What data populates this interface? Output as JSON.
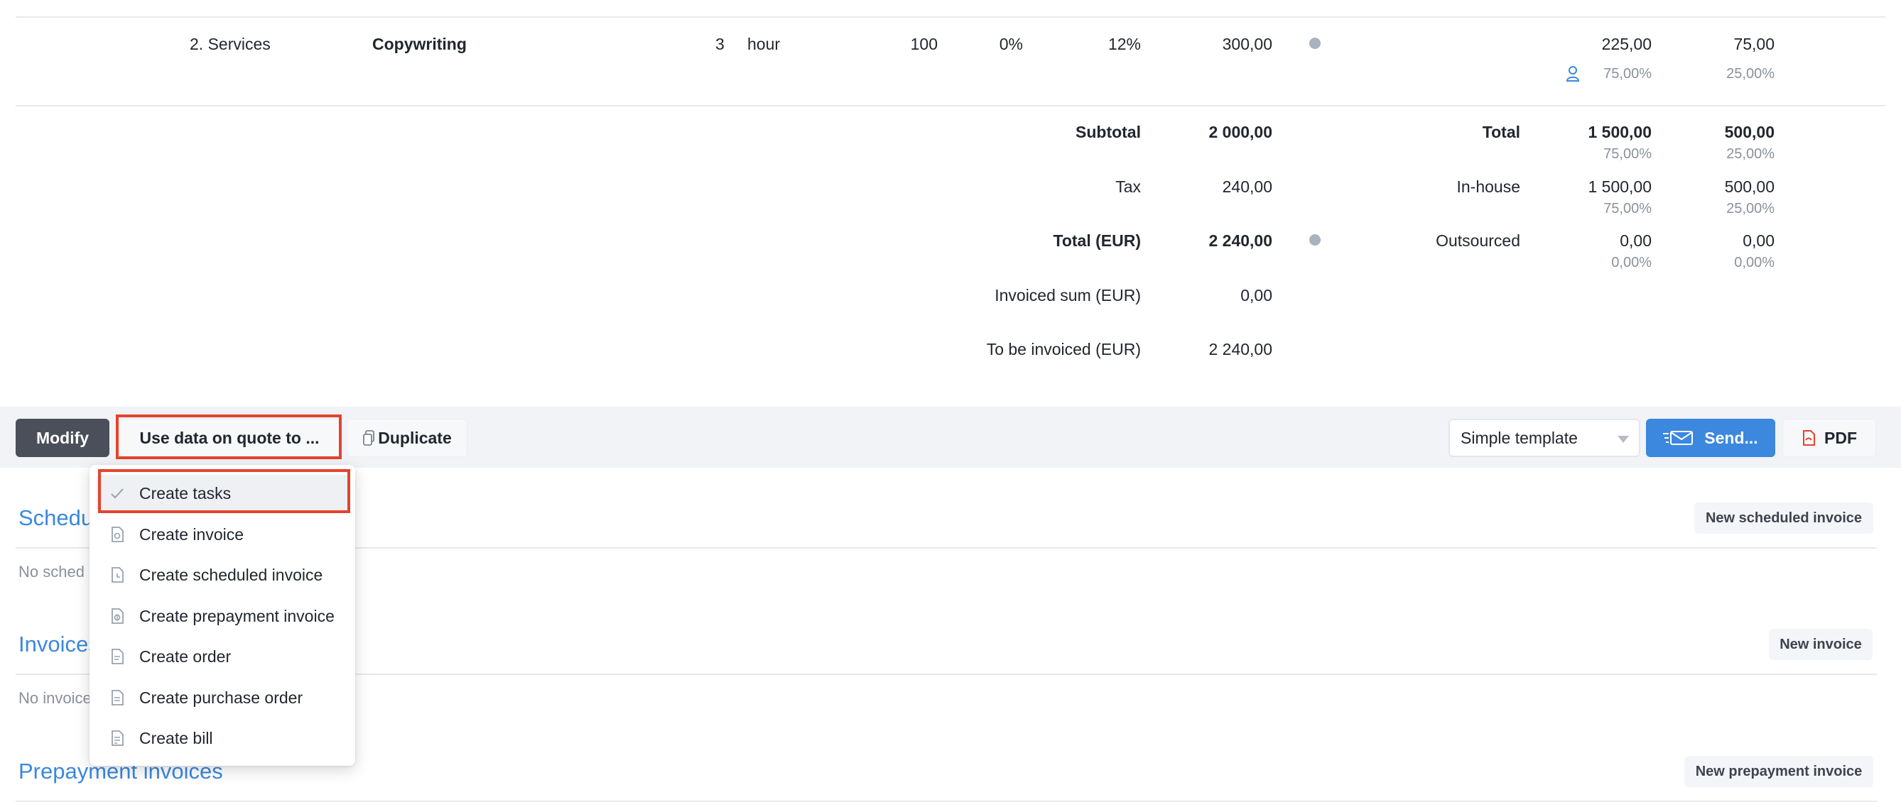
{
  "line_item": {
    "category": "2. Services",
    "name": "Copywriting",
    "quantity": "3",
    "unit": "hour",
    "price": "100",
    "discount": "0%",
    "vat": "12%",
    "sum": "300,00",
    "inhouse_value": "225,00",
    "outsourced_value": "75,00",
    "inhouse_pct": "75,00%",
    "outsourced_pct": "25,00%"
  },
  "totals": {
    "subtotal_label": "Subtotal",
    "subtotal_value": "2 000,00",
    "tax_label": "Tax",
    "tax_value": "240,00",
    "total_label": "Total (EUR)",
    "total_value": "2 240,00",
    "invoiced_label": "Invoiced sum (EUR)",
    "invoiced_value": "0,00",
    "tobe_label": "To be invoiced (EUR)",
    "tobe_value": "2 240,00"
  },
  "split": {
    "total_label": "Total",
    "total_a": "1 500,00",
    "total_a_pct": "75,00%",
    "total_b": "500,00",
    "total_b_pct": "25,00%",
    "inhouse_label": "In-house",
    "inhouse_a": "1 500,00",
    "inhouse_a_pct": "75,00%",
    "inhouse_b": "500,00",
    "inhouse_b_pct": "25,00%",
    "outsourced_label": "Outsourced",
    "outsourced_a": "0,00",
    "outsourced_a_pct": "0,00%",
    "outsourced_b": "0,00",
    "outsourced_b_pct": "0,00%"
  },
  "toolbar": {
    "modify": "Modify",
    "use_data": "Use data on quote to ...",
    "duplicate": "Duplicate",
    "template_value": "Simple template",
    "send": "Send...",
    "pdf": "PDF"
  },
  "menu": {
    "items": [
      {
        "label": "Create tasks",
        "icon": "check-icon"
      },
      {
        "label": "Create invoice",
        "icon": "invoice-icon"
      },
      {
        "label": "Create scheduled invoice",
        "icon": "scheduled-invoice-icon"
      },
      {
        "label": "Create prepayment invoice",
        "icon": "prepayment-invoice-icon"
      },
      {
        "label": "Create order",
        "icon": "order-icon"
      },
      {
        "label": "Create purchase order",
        "icon": "purchase-order-icon"
      },
      {
        "label": "Create bill",
        "icon": "bill-icon"
      }
    ]
  },
  "sections": {
    "scheduled_title": "Schedu",
    "scheduled_empty": "No sched",
    "scheduled_button": "New scheduled invoice",
    "invoices_title": "Invoices",
    "invoices_empty": "No invoice",
    "invoices_button": "New invoice",
    "prepayment_title": "Prepayment invoices",
    "prepayment_button": "New prepayment invoice"
  },
  "colors": {
    "accent": "#3b88de",
    "highlight": "#e5432c",
    "dark_button": "#4a4f59",
    "pdf_icon": "#e5432c"
  }
}
